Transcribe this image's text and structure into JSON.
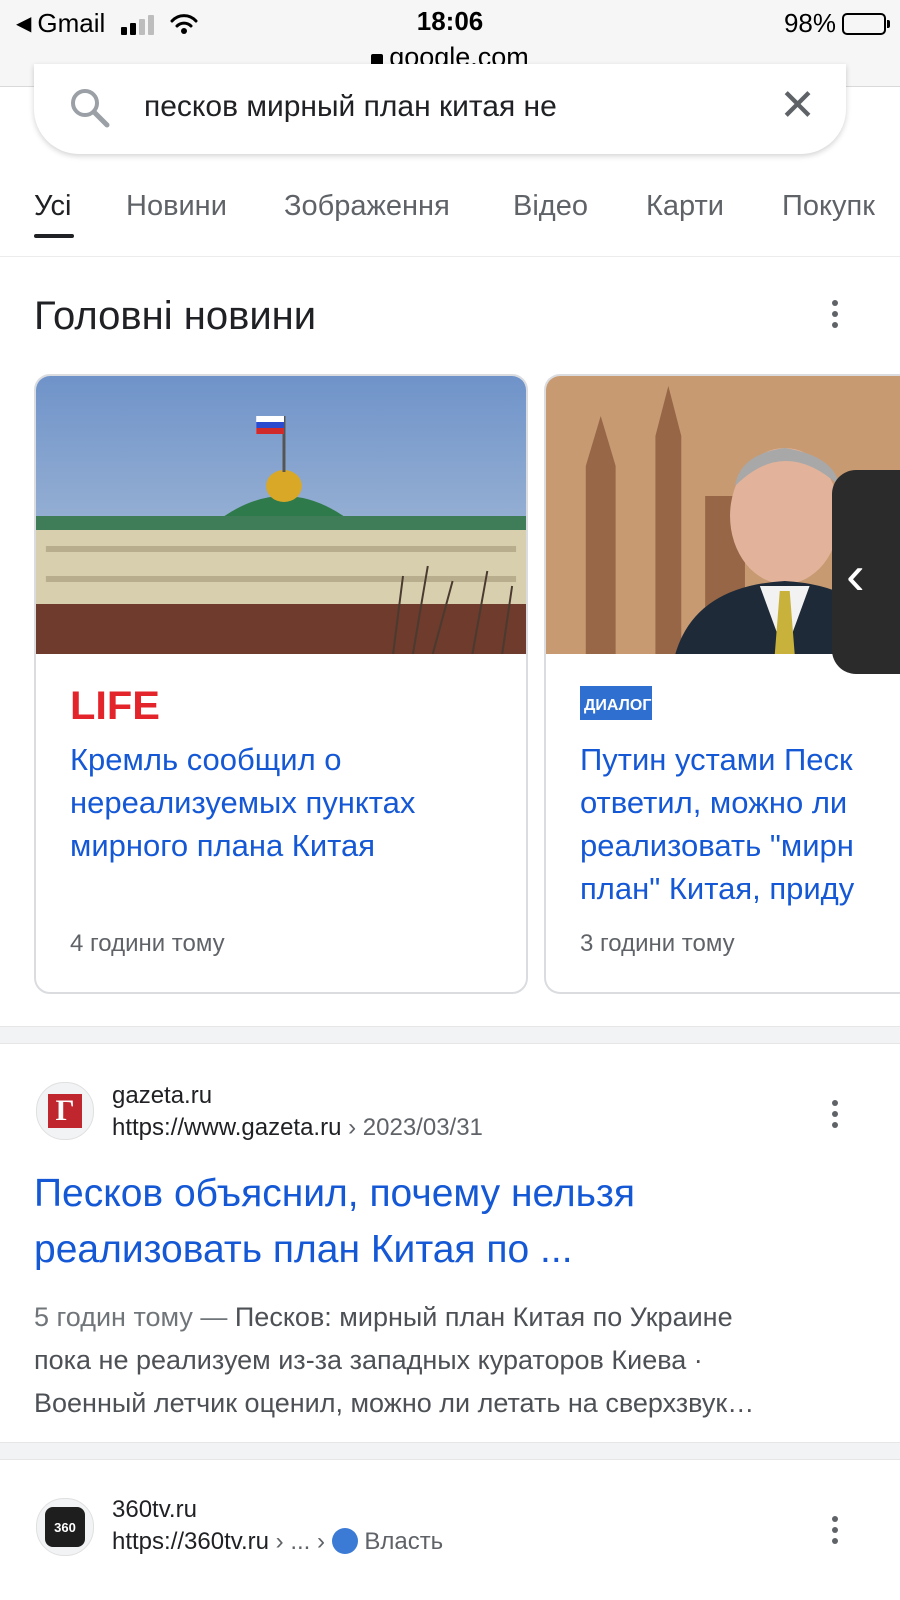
{
  "status_bar": {
    "back_app": "Gmail",
    "time": "18:06",
    "url": "google.com",
    "battery": "98%"
  },
  "search": {
    "query": "песков мирный план китая не"
  },
  "tabs": [
    {
      "label": "Усі",
      "active": true
    },
    {
      "label": "Новини"
    },
    {
      "label": "Зображення"
    },
    {
      "label": "Відео"
    },
    {
      "label": "Карти"
    },
    {
      "label": "Покупк"
    }
  ],
  "top_news": {
    "heading": "Головні новини",
    "cards": [
      {
        "source": "LIFE",
        "title_lines": [
          "Кремль сообщил о",
          "нереализуемых пунктах",
          "мирного плана Китая"
        ],
        "time": "4 години тому"
      },
      {
        "source": "ДИАЛОГ",
        "title_lines": [
          "Путин устами Песк",
          "ответил, можно ли",
          "реализовать \"мирн",
          "план\" Китая, приду"
        ],
        "time": "3 години тому"
      }
    ]
  },
  "results": [
    {
      "favicon": "Г",
      "site": "gazeta.ru",
      "url": "https://www.gazeta.ru",
      "url_crumb": "› 2023/03/31",
      "title_lines": [
        "Песков объяснил, почему нельзя",
        "реализовать план Китая по ..."
      ],
      "snippet_date": "5 годин тому —",
      "snippet_lines": [
        " Песков: мирный план Китая по Украине",
        "пока не реализуем из-за западных кураторов Киева ·",
        "Военный летчик оценил, можно ли летать на сверхзвук…"
      ]
    },
    {
      "favicon": "360",
      "site": "360tv.ru",
      "url": "https://360tv.ru",
      "url_crumb": "› ... ›",
      "url_section": "Власть"
    }
  ],
  "colors": {
    "link": "#1558d6",
    "life_red": "#e3242b",
    "dialog_blue": "#2f6fd0"
  }
}
